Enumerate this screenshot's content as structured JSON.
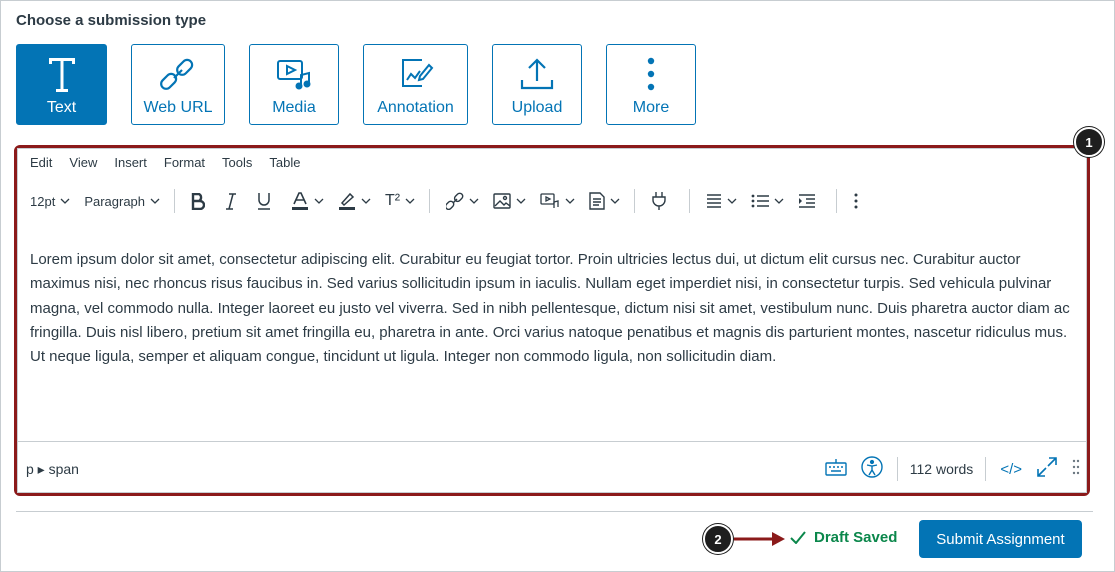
{
  "heading": "Choose a submission type",
  "submission_types": [
    {
      "label": "Text",
      "icon": "text-icon",
      "active": true
    },
    {
      "label": "Web URL",
      "icon": "link-icon"
    },
    {
      "label": "Media",
      "icon": "media-icon"
    },
    {
      "label": "Annotation",
      "icon": "annotation-icon"
    },
    {
      "label": "Upload",
      "icon": "upload-icon"
    },
    {
      "label": "More",
      "icon": "more-icon"
    }
  ],
  "editor": {
    "menu": [
      "Edit",
      "View",
      "Insert",
      "Format",
      "Tools",
      "Table"
    ],
    "font_size": "12pt",
    "block_format": "Paragraph",
    "superscript_label": "T²",
    "body_text": "Lorem ipsum dolor sit amet, consectetur adipiscing elit. Curabitur eu feugiat tortor. Proin ultricies lectus dui, ut dictum elit cursus nec. Curabitur auctor maximus nisi, nec rhoncus risus faucibus in. Sed varius sollicitudin ipsum in iaculis. Nullam eget imperdiet nisi, in consectetur turpis. Sed vehicula pulvinar magna, vel commodo nulla. Integer laoreet eu justo vel viverra. Sed in nibh pellentesque, dictum nisi sit amet, vestibulum nunc. Duis pharetra auctor diam ac fringilla. Duis nisl libero, pretium sit amet fringilla eu, pharetra in ante. Orci varius natoque penatibus et magnis dis parturient montes, nascetur ridiculus mus. Ut neque ligula, semper et aliquam congue, tincidunt ut ligula. Integer non commodo ligula, non sollicitudin diam.",
    "element_path": "p ▸ span",
    "word_count": "112 words",
    "html_toggle_label": "</>"
  },
  "callouts": {
    "one": "1",
    "two": "2"
  },
  "draft_status": "Draft Saved",
  "submit_label": "Submit Assignment",
  "colors": {
    "primary": "#0374b5",
    "success": "#0b874b",
    "highlight": "#8b1a1a"
  }
}
